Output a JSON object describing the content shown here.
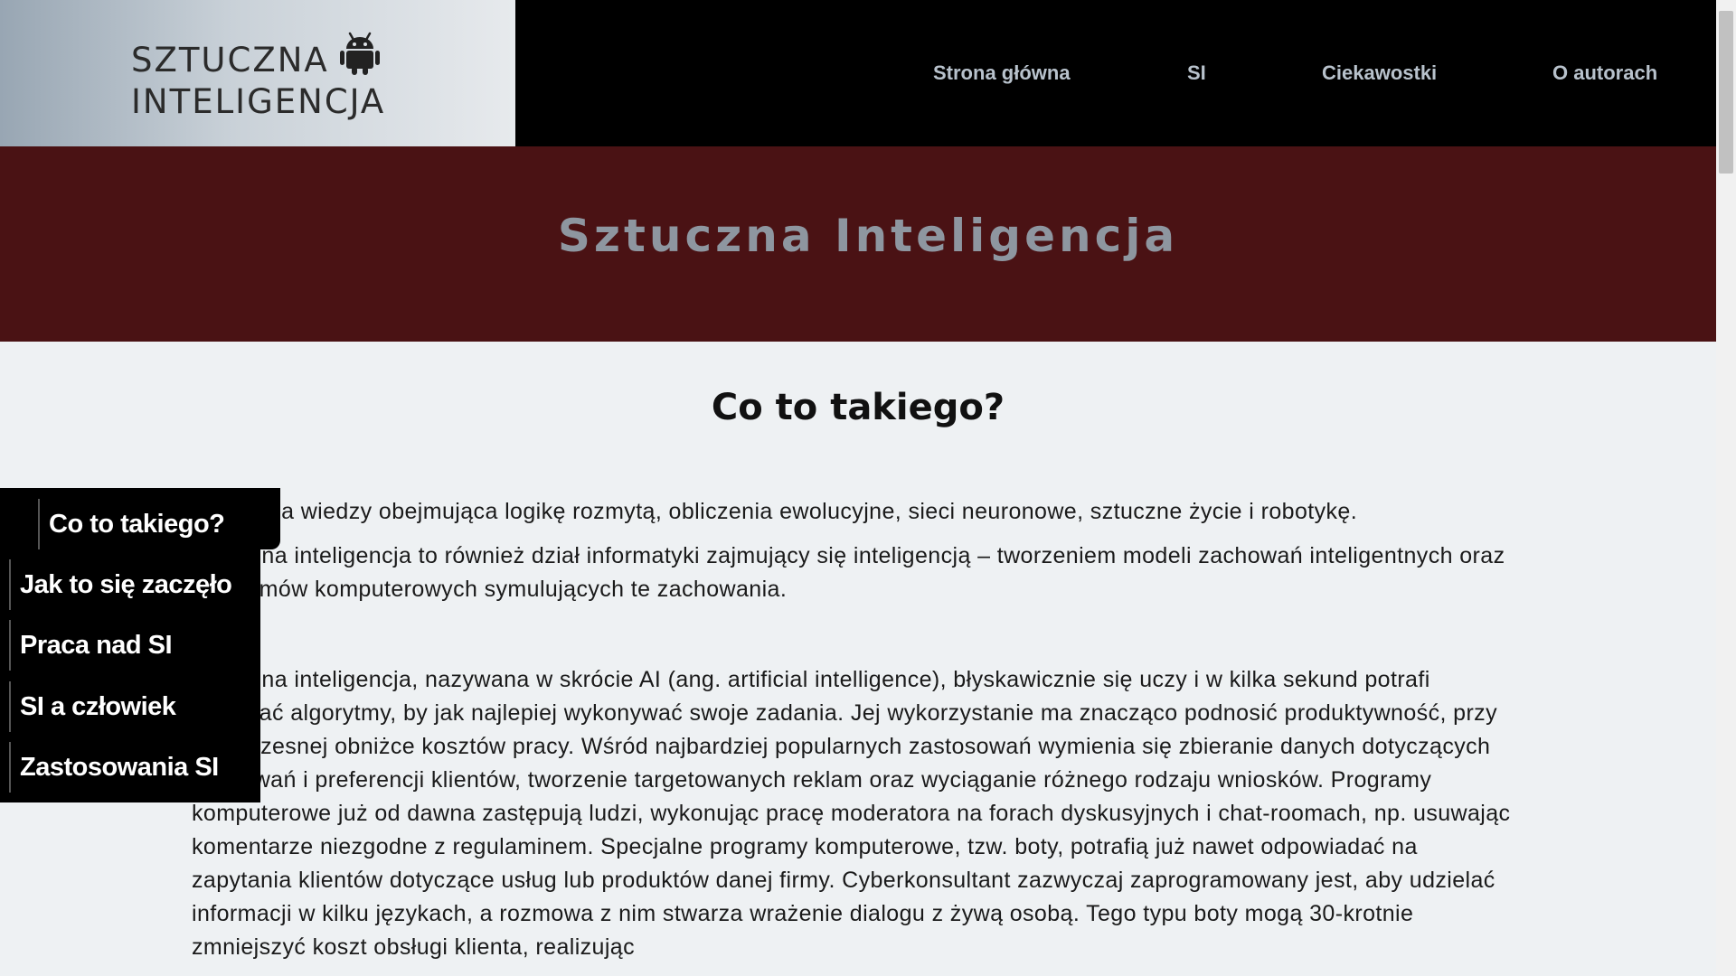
{
  "header": {
    "logo_line1": "SZTUCZNA",
    "logo_line2": "INTELIGENCJA",
    "logo_icon": "android-icon",
    "nav": [
      {
        "label": "Strona główna"
      },
      {
        "label": "SI"
      },
      {
        "label": "Ciekawostki"
      },
      {
        "label": "O autorach"
      }
    ]
  },
  "banner": {
    "title": "Sztuczna Inteligencja"
  },
  "main": {
    "section_title": "Co to takiego?",
    "paragraph1_line1": "Dziedzina wiedzy obejmująca logikę rozmytą, obliczenia ewolucyjne, sieci neuronowe, sztuczne życie i robotykę.",
    "paragraph1_line2": "Sztuczna inteligencja to również dział informatyki zajmujący się inteligencją – tworzeniem modeli zachowań inteligentnych oraz programów komputerowych symulujących te zachowania.",
    "paragraph2": "Sztuczna inteligencja, nazywana w skrócie AI (ang. artificial intelligence), błyskawicznie się uczy i w kilka sekund potrafi zmieniać algorytmy, by jak najlepiej wykonywać swoje zadania. Jej wykorzystanie ma znacząco podnosić produktywność, przy jednoczesnej obniżce kosztów pracy. Wśród najbardziej popularnych zastosowań wymienia się zbieranie danych dotyczących zachowań i preferencji klientów, tworzenie targetowanych reklam oraz wyciąganie różnego rodzaju wniosków. Programy komputerowe już od dawna zastępują ludzi, wykonując pracę moderatora na forach dyskusyjnych i chat-roomach, np. usuwając komentarze niezgodne z regulaminem. Specjalne programy komputerowe, tzw. boty, potrafią już nawet odpowiadać na zapytania klientów dotyczące usług lub produktów danej firmy. Cyberkonsultant zazwyczaj zaprogramowany jest, aby udzielać informacji w kilku językach, a rozmowa z nim stwarza wrażenie dialogu z żywą osobą. Tego typu boty mogą 30-krotnie zmniejszyć koszt obsługi klienta, realizując"
  },
  "side_menu": {
    "items": [
      {
        "label": "Co to takiego?"
      },
      {
        "label": "Jak to się zaczęło"
      },
      {
        "label": "Praca nad SI"
      },
      {
        "label": "SI a człowiek"
      },
      {
        "label": "Zastosowania SI"
      }
    ]
  },
  "colors": {
    "header_bg": "#000000",
    "banner_bg": "#4a1214",
    "page_bg": "#eef1f3",
    "nav_text": "#b8c2cc",
    "banner_text": "#8e96a0"
  }
}
